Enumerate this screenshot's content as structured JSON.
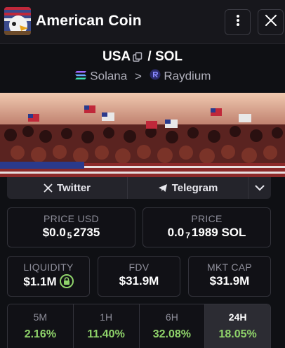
{
  "header": {
    "title": "American Coin"
  },
  "pair": {
    "base": "USA",
    "separator": "/",
    "quote": "SOL"
  },
  "chain": {
    "network": "Solana",
    "arrow": ">",
    "dex": "Raydium"
  },
  "social": {
    "twitter_label": "Twitter",
    "telegram_label": "Telegram"
  },
  "stats": {
    "price_usd": {
      "label": "PRICE USD",
      "prefix": "$0.0",
      "sub": "5",
      "suffix": "2735"
    },
    "price_sol": {
      "label": "PRICE",
      "prefix": "0.0",
      "sub": "7",
      "suffix": "1989 SOL"
    },
    "liquidity": {
      "label": "LIQUIDITY",
      "value": "$1.1M"
    },
    "fdv": {
      "label": "FDV",
      "value": "$31.9M"
    },
    "mkt_cap": {
      "label": "MKT CAP",
      "value": "$31.9M"
    }
  },
  "timeframes": [
    {
      "label": "5M",
      "value": "2.16%"
    },
    {
      "label": "1H",
      "value": "11.40%"
    },
    {
      "label": "6H",
      "value": "32.08%"
    },
    {
      "label": "24H",
      "value": "18.05%",
      "active": true
    }
  ],
  "colors": {
    "positive": "#8fd36a",
    "background": "#0f1014",
    "card_border": "#33333b"
  }
}
